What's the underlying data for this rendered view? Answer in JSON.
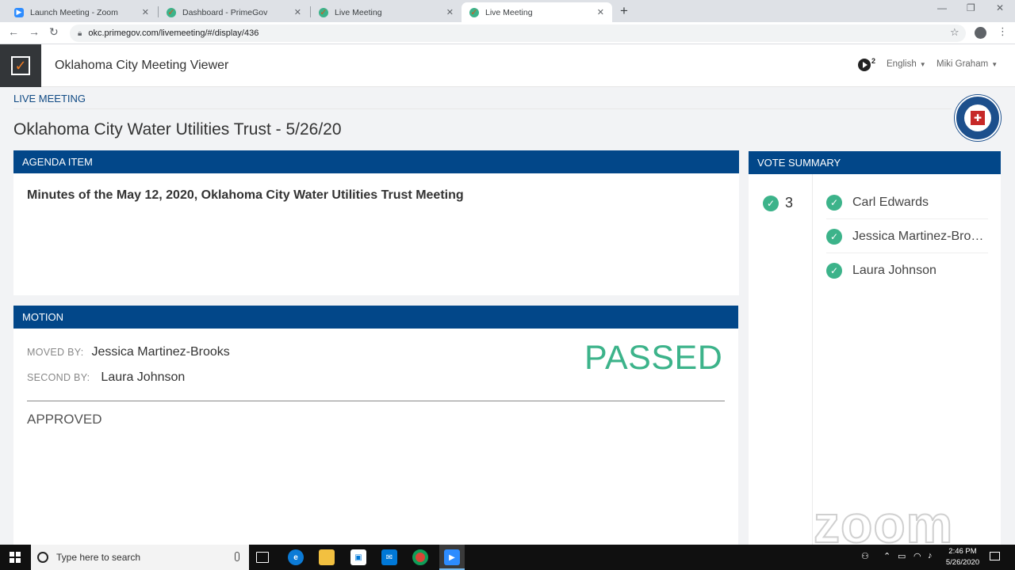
{
  "browser": {
    "tabs": [
      {
        "label": "Launch Meeting - Zoom",
        "icon": "zoom-icon"
      },
      {
        "label": "Dashboard - PrimeGov",
        "icon": "checkbox-icon"
      },
      {
        "label": "Live Meeting",
        "icon": "checkbox-icon"
      },
      {
        "label": "Live Meeting",
        "icon": "checkbox-icon",
        "active": true
      }
    ],
    "url": "okc.primegov.com/livemeeting/#/display/436"
  },
  "app": {
    "title": "Oklahoma City Meeting Viewer",
    "notification_count": "2",
    "language": "English",
    "user": "Miki Graham",
    "accent_color": "#024789"
  },
  "page": {
    "breadcrumb": "LIVE MEETING",
    "meeting_title": "Oklahoma City Water Utilities Trust - 5/26/20"
  },
  "agenda": {
    "header": "AGENDA ITEM",
    "item": "Minutes of the May 12, 2020, Oklahoma City Water Utilities Trust Meeting"
  },
  "motion": {
    "header": "MOTION",
    "moved_by_label": "MOVED BY:",
    "moved_by": "Jessica Martinez-Brooks",
    "second_by_label": "SECOND BY:",
    "second_by": "Laura Johnson",
    "result": "PASSED",
    "result_color": "#3cb38a",
    "outcome": "APPROVED"
  },
  "votes": {
    "header": "VOTE SUMMARY",
    "yes_count": "3",
    "voters": [
      "Carl Edwards",
      "Jessica Martinez-Brooks",
      "Laura Johnson"
    ]
  },
  "watermark": "zoom",
  "taskbar": {
    "search_placeholder": "Type here to search",
    "time": "2:46 PM",
    "date": "5/26/2020"
  }
}
